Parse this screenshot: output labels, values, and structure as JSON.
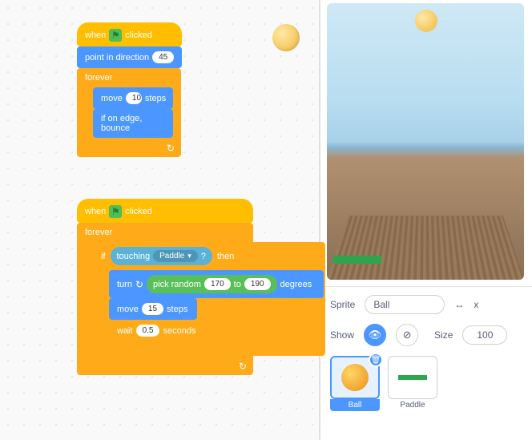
{
  "script1": {
    "hat_prefix": "when",
    "hat_suffix": "clicked",
    "point_label_a": "point in direction",
    "point_val": "45",
    "forever": "forever",
    "move_a": "move",
    "move_val": "10",
    "move_b": "steps",
    "bounce": "if on edge, bounce"
  },
  "script2": {
    "hat_prefix": "when",
    "hat_suffix": "clicked",
    "forever": "forever",
    "if_a": "if",
    "if_b": "then",
    "touch_a": "touching",
    "touch_target": "Paddle",
    "touch_q": "?",
    "turn_a": "turn",
    "turn_b": "degrees",
    "rand_a": "pick random",
    "rand_lo": "170",
    "rand_mid": "to",
    "rand_hi": "190",
    "move_a": "move",
    "move_val": "15",
    "move_b": "steps",
    "wait_a": "wait",
    "wait_val": "0.5",
    "wait_b": "seconds"
  },
  "panel": {
    "sprite_label": "Sprite",
    "sprite_name": "Ball",
    "x_icon": "↔",
    "x_label": "x",
    "show_label": "Show",
    "size_label": "Size",
    "size_val": "100",
    "thumb_ball": "Ball",
    "thumb_paddle": "Paddle"
  }
}
